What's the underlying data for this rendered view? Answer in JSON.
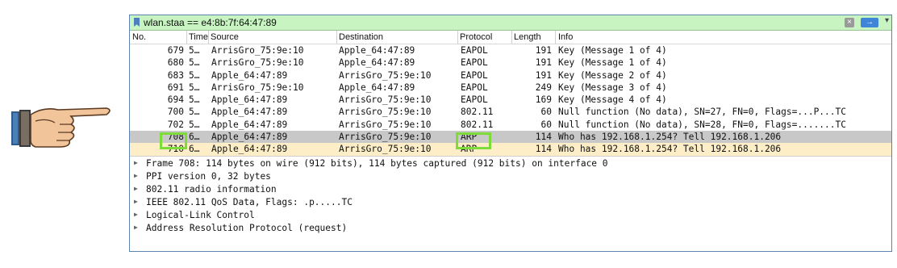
{
  "filter": {
    "expression": "wlan.staa == e4:8b:7f:64:47:89",
    "clear_icon": "×",
    "apply_icon": "→",
    "dropdown_icon": "▾"
  },
  "columns": {
    "no": "No.",
    "time": "Time",
    "source": "Source",
    "destination": "Destination",
    "protocol": "Protocol",
    "length": "Length",
    "info": "Info"
  },
  "packets": [
    {
      "no": "679",
      "time": "5…",
      "source": "ArrisGro_75:9e:10",
      "destination": "Apple_64:47:89",
      "protocol": "EAPOL",
      "length": "191",
      "info": "Key (Message 1 of 4)"
    },
    {
      "no": "680",
      "time": "5…",
      "source": "ArrisGro_75:9e:10",
      "destination": "Apple_64:47:89",
      "protocol": "EAPOL",
      "length": "191",
      "info": "Key (Message 1 of 4)"
    },
    {
      "no": "683",
      "time": "5…",
      "source": "Apple_64:47:89",
      "destination": "ArrisGro_75:9e:10",
      "protocol": "EAPOL",
      "length": "191",
      "info": "Key (Message 2 of 4)"
    },
    {
      "no": "691",
      "time": "5…",
      "source": "ArrisGro_75:9e:10",
      "destination": "Apple_64:47:89",
      "protocol": "EAPOL",
      "length": "249",
      "info": "Key (Message 3 of 4)"
    },
    {
      "no": "694",
      "time": "5…",
      "source": "Apple_64:47:89",
      "destination": "ArrisGro_75:9e:10",
      "protocol": "EAPOL",
      "length": "169",
      "info": "Key (Message 4 of 4)"
    },
    {
      "no": "700",
      "time": "5…",
      "source": "Apple_64:47:89",
      "destination": "ArrisGro_75:9e:10",
      "protocol": "802.11",
      "length": "60",
      "info": "Null function (No data), SN=27, FN=0, Flags=...P...TC"
    },
    {
      "no": "702",
      "time": "5…",
      "source": "Apple_64:47:89",
      "destination": "ArrisGro_75:9e:10",
      "protocol": "802.11",
      "length": "60",
      "info": "Null function (No data), SN=28, FN=0, Flags=.......TC"
    },
    {
      "no": "708",
      "time": "6…",
      "source": "Apple_64:47:89",
      "destination": "ArrisGro_75:9e:10",
      "protocol": "ARP",
      "length": "114",
      "info": "Who has 192.168.1.254? Tell 192.168.1.206"
    },
    {
      "no": "710",
      "time": "6…",
      "source": "Apple_64:47:89",
      "destination": "ArrisGro_75:9e:10",
      "protocol": "ARP",
      "length": "114",
      "info": "Who has 192.168.1.254? Tell 192.168.1.206"
    }
  ],
  "details": [
    "Frame 708: 114 bytes on wire (912 bits), 114 bytes captured (912 bits) on interface 0",
    "PPI version 0, 32 bytes",
    "802.11 radio information",
    "IEEE 802.11 QoS Data, Flags: .p.....TC",
    "Logical-Link Control",
    "Address Resolution Protocol (request)"
  ],
  "expand_icon": "▶",
  "colors": {
    "filter_bg": "#c7f4c1",
    "selected_row": "#c8c8c8",
    "alt_row": "#fdeec7",
    "highlight_box": "#7ddc3a",
    "apply_button": "#3f86d8"
  }
}
